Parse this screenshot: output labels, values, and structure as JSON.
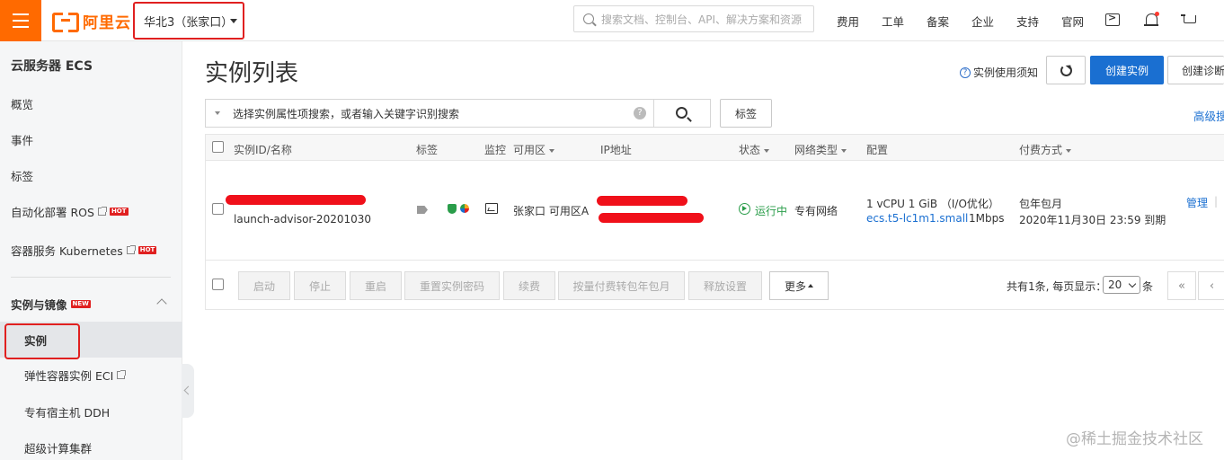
{
  "header": {
    "logo_text": "阿里云",
    "region": "华北3（张家口）",
    "search_placeholder": "搜索文档、控制台、API、解决方案和资源",
    "nav": [
      "费用",
      "工单",
      "备案",
      "企业",
      "支持",
      "官网"
    ]
  },
  "sidebar": {
    "title": "云服务器 ECS",
    "items": [
      "概览",
      "事件",
      "标签",
      "自动化部署 ROS",
      "容器服务 Kubernetes"
    ],
    "hot_badge": "HOT",
    "new_badge": "NEW",
    "group_title": "实例与镜像",
    "sub_items": [
      "实例",
      "弹性容器实例 ECI",
      "专有宿主机 DDH",
      "超级计算集群"
    ]
  },
  "main": {
    "title": "实例列表",
    "help_link": "实例使用须知",
    "create_button": "创建实例",
    "diagnose_button": "创建诊断",
    "filter_placeholder": "选择实例属性项搜索，或者输入关键字识别搜索",
    "tag_button": "标签",
    "advanced_search": "高级搜"
  },
  "table": {
    "headers": [
      "实例ID/名称",
      "标签",
      "监控",
      "可用区",
      "IP地址",
      "状态",
      "网络类型",
      "配置",
      "付费方式"
    ],
    "row": {
      "name": "launch-advisor-20201030",
      "zone": "张家口 可用区A",
      "status": "运行中",
      "network": "专有网络",
      "config_line1": "1 vCPU 1 GiB （I/O优化）",
      "instance_type": "ecs.t5-lc1m1.small",
      "bandwidth": "1Mbps",
      "billing_line1": "包年包月",
      "billing_line2": "2020年11月30日 23:59 到期",
      "action": "管理",
      "action_sep": "|"
    }
  },
  "footer": {
    "buttons": [
      "启动",
      "停止",
      "重启",
      "重置实例密码",
      "续费",
      "按量付费转包年包月",
      "释放设置"
    ],
    "more_button": "更多",
    "pager_text": "共有1条, 每页显示：",
    "page_size": "20",
    "pager_unit": "条",
    "first_page": "«",
    "prev_page": "‹"
  },
  "watermark": "@稀土掘金技术社区",
  "colors": {
    "brand": "#ff6a00",
    "primary": "#1a6fd1",
    "highlight": "#e02020",
    "running": "#2a9d4a"
  }
}
